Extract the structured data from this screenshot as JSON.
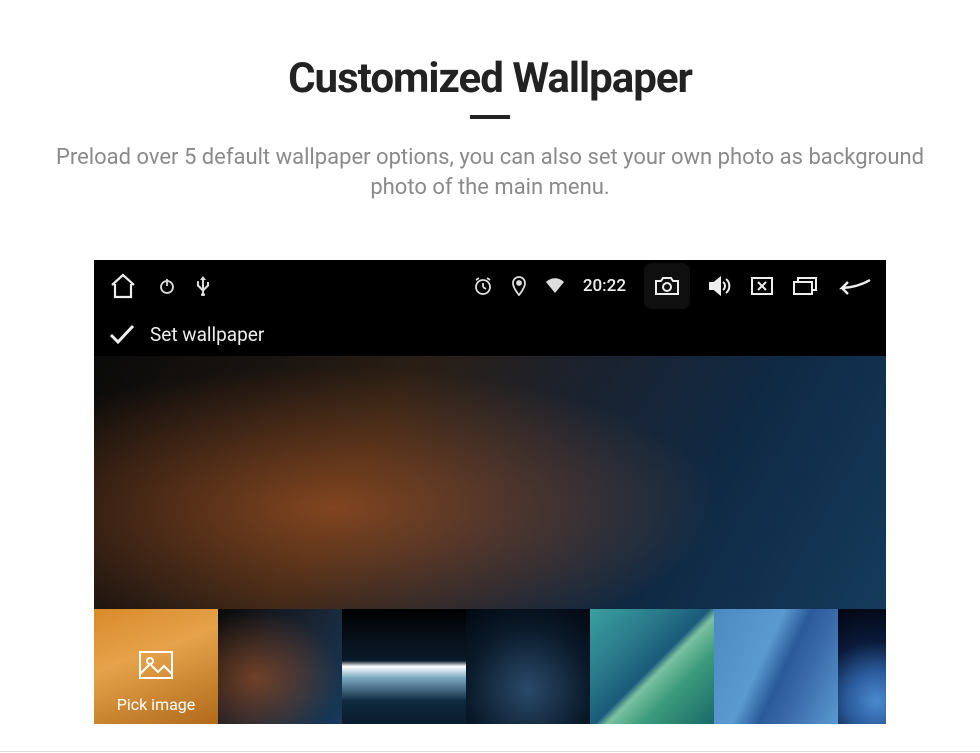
{
  "page": {
    "title": "Customized Wallpaper",
    "description": "Preload over 5 default wallpaper options, you can also set your own photo as background photo of the main menu."
  },
  "statusbar": {
    "time": "20:22"
  },
  "screen": {
    "title": "Set wallpaper"
  },
  "thumbs": {
    "pick_label": "Pick image"
  },
  "icons": {
    "home": "home-icon",
    "power": "power-icon",
    "usb": "usb-icon",
    "alarm": "alarm-icon",
    "location": "location-icon",
    "wifi": "wifi-icon",
    "camera": "camera-icon",
    "volume": "volume-icon",
    "close_window": "close-window-icon",
    "recent": "recent-apps-icon",
    "back": "back-icon",
    "check": "check-icon",
    "image": "image-icon"
  }
}
